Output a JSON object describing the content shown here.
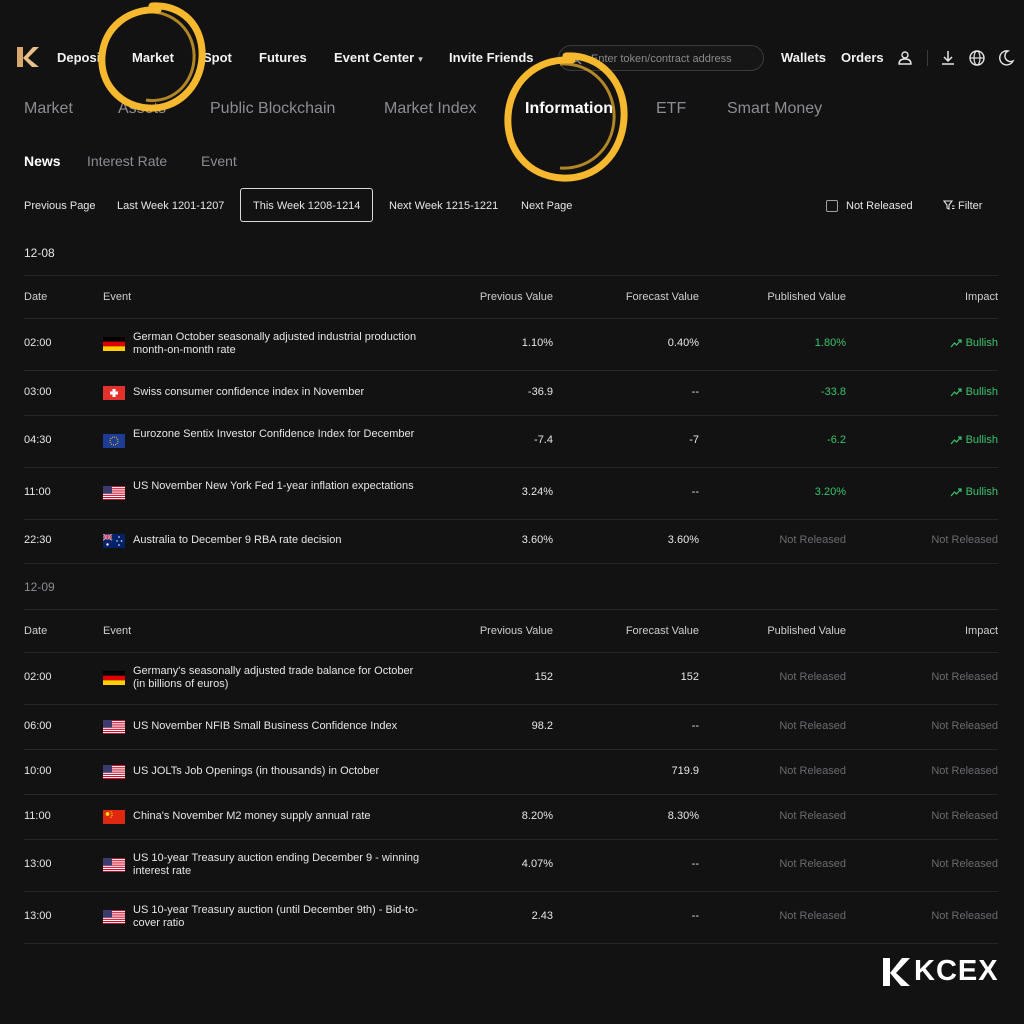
{
  "nav": {
    "items": [
      "Deposit",
      "Market",
      "Spot",
      "Futures",
      "Event Center",
      "Invite Friends"
    ],
    "search_placeholder": "Enter token/contract address",
    "right_items": [
      "Wallets",
      "Orders"
    ],
    "icons": [
      "user-icon",
      "download-icon",
      "globe-icon",
      "moon-icon"
    ]
  },
  "tabs1": {
    "items": [
      "Market",
      "Assets",
      "Public Blockchain",
      "Market Index",
      "Information",
      "ETF",
      "Smart Money"
    ],
    "active": "Information"
  },
  "tabs2": {
    "items": [
      "News",
      "Interest Rate",
      "Event"
    ],
    "active": "News"
  },
  "weekbar": {
    "prev": "Previous Page",
    "last": "Last Week 1201-1207",
    "this": "This Week 1208-1214",
    "next_week": "Next Week 1215-1221",
    "next": "Next Page",
    "not_released": "Not Released",
    "filter": "Filter"
  },
  "columns": {
    "date": "Date",
    "event": "Event",
    "previous": "Previous Value",
    "forecast": "Forecast Value",
    "published": "Published Value",
    "impact": "Impact"
  },
  "days": [
    {
      "date": "12-08",
      "rows": [
        {
          "time": "02:00",
          "flag": "germany",
          "event": "German October seasonally adjusted industrial production month-on-month rate",
          "previous": "1.10%",
          "forecast": "0.40%",
          "published": "1.80%",
          "impact": "Bullish"
        },
        {
          "time": "03:00",
          "flag": "switzerland",
          "event": "Swiss consumer confidence index in November",
          "previous": "-36.9",
          "forecast": "--",
          "published": "-33.8",
          "impact": "Bullish"
        },
        {
          "time": "04:30",
          "flag": "eu",
          "event": "Eurozone Sentix Investor Confidence Index for December",
          "previous": "-7.4",
          "forecast": "-7",
          "published": "-6.2",
          "impact": "Bullish"
        },
        {
          "time": "11:00",
          "flag": "us",
          "event": "US November New York Fed 1-year inflation expectations",
          "previous": "3.24%",
          "forecast": "--",
          "published": "3.20%",
          "impact": "Bullish"
        },
        {
          "time": "22:30",
          "flag": "australia",
          "event": "Australia to December 9 RBA rate decision",
          "previous": "3.60%",
          "forecast": "3.60%",
          "published": "Not Released",
          "impact": "Not Released"
        }
      ]
    },
    {
      "date": "12-09",
      "rows": [
        {
          "time": "02:00",
          "flag": "germany",
          "event": "Germany's seasonally adjusted trade balance for October (in billions of euros)",
          "previous": "152",
          "forecast": "152",
          "published": "Not Released",
          "impact": "Not Released"
        },
        {
          "time": "06:00",
          "flag": "us",
          "event": "US November NFIB Small Business Confidence Index",
          "previous": "98.2",
          "forecast": "--",
          "published": "Not Released",
          "impact": "Not Released"
        },
        {
          "time": "10:00",
          "flag": "us",
          "event": "US JOLTs Job Openings (in thousands) in October",
          "previous": "",
          "forecast": "719.9",
          "published": "Not Released",
          "impact": "Not Released"
        },
        {
          "time": "11:00",
          "flag": "china",
          "event": "China's November M2 money supply annual rate",
          "previous": "8.20%",
          "forecast": "8.30%",
          "published": "Not Released",
          "impact": "Not Released"
        },
        {
          "time": "13:00",
          "flag": "us",
          "event": "US 10-year Treasury auction ending December 9 - winning interest rate",
          "previous": "4.07%",
          "forecast": "--",
          "published": "Not Released",
          "impact": "Not Released"
        },
        {
          "time": "13:00",
          "flag": "us",
          "event": "US 10-year Treasury auction (until December 9th) - Bid-to-cover ratio",
          "previous": "2.43",
          "forecast": "--",
          "published": "Not Released",
          "impact": "Not Released"
        }
      ]
    }
  ],
  "brand": {
    "name": "KCEX"
  },
  "colors": {
    "accent": "#f5b82e",
    "bullish": "#3cc46f",
    "muted": "#6b6b70",
    "background": "#121212"
  }
}
